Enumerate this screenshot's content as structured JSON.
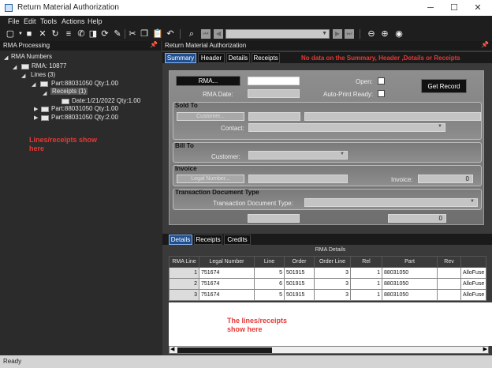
{
  "window": {
    "title": "Return Material Authorization",
    "controls": {
      "minimize": "─",
      "maximize": "☐",
      "close": "✕"
    }
  },
  "menu": [
    "File",
    "Edit",
    "Tools",
    "Actions",
    "Help"
  ],
  "left_panel": {
    "title": "RMA Processing",
    "tree": {
      "root": "RMA Numbers",
      "rma": "RMA: 10877",
      "lines": "Lines (3)",
      "line1": "Part:88031050 Qty:1.00",
      "receipts": "Receipts (1)",
      "receipt_date": "Date:1/21/2022 Qty:1.00",
      "line2": "Part:88031050 Qty:1.00",
      "line3": "Part:88031050 Qty:2.00"
    },
    "note": "Lines/receipts show here"
  },
  "right_panel": {
    "title": "Return Material Authorization",
    "tabs": [
      "Summary",
      "Header",
      "Details",
      "Receipts"
    ],
    "note": "No data on the Summary, Header ,Details or Receipts",
    "form": {
      "rma_button": "RMA...",
      "rma_date_label": "RMA Date:",
      "open_label": "Open:",
      "auto_print_label": "Auto-Print Ready:",
      "get_record": "Get Record",
      "sold_to": "Sold To",
      "customer_button": "Customer...",
      "contact_label": "Contact:",
      "bill_to": "Bill To",
      "customer_label": "Customer:",
      "invoice_group": "Invoice",
      "legal_number_button": "Legal Number...",
      "invoice_label": "Invoice:",
      "invoice_value": "0",
      "tdt_group": "Transaction Document Type",
      "tdt_label": "Transaction Document Type:",
      "total_value": "0"
    },
    "bottom_tabs": [
      "Details",
      "Receipts",
      "Credits"
    ],
    "grid": {
      "title": "RMA Details",
      "columns": [
        "RMA Line",
        "Legal Number",
        "Line",
        "Order",
        "Order Line",
        "Rel",
        "Part",
        "Rev",
        ""
      ],
      "rows": [
        [
          "1",
          "751674",
          "5",
          "501915",
          "3",
          "1",
          "88031050",
          "",
          "AlloFuse"
        ],
        [
          "2",
          "751674",
          "6",
          "501915",
          "3",
          "1",
          "88031050",
          "",
          "AlloFuse"
        ],
        [
          "3",
          "751674",
          "5",
          "501915",
          "3",
          "1",
          "88031050",
          "",
          "AlloFuse"
        ]
      ],
      "note": "The lines/receipts show here"
    }
  },
  "status": "Ready"
}
